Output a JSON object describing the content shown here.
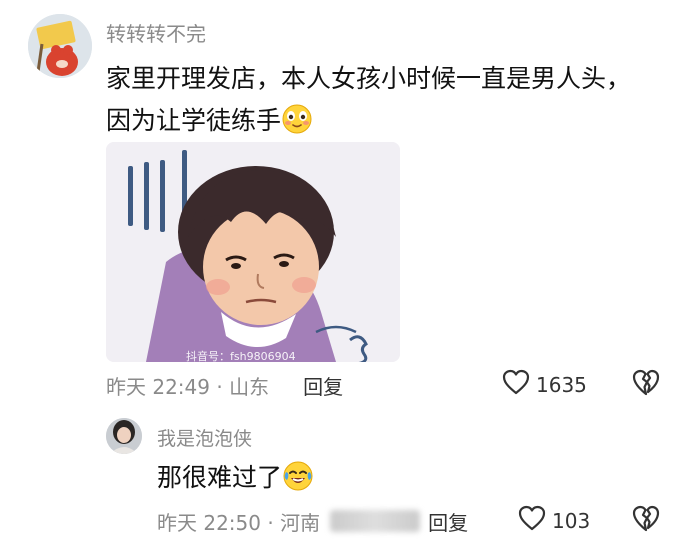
{
  "comment": {
    "username": "转转转不完",
    "text_line1": "家里开理发店，本人女孩小时候一直是男人头，",
    "text_line2": "因为让学徒练手",
    "inline_emoji": "smiling-face-emoji",
    "image_watermark": "抖音号：fsh9806904",
    "time": "昨天 22:49 · 山东",
    "reply_label": "回复",
    "like_count": "1635"
  },
  "reply": {
    "username": "我是泡泡侠",
    "text": "那很难过了",
    "inline_emoji": "crying-laughing-emoji",
    "time": "昨天 22:50 · 河南",
    "reply_label": "回复",
    "like_count": "103"
  },
  "icons": {
    "like": "heart-outline-icon",
    "dislike": "broken-heart-icon"
  },
  "colors": {
    "meta_gray": "#8a8a8a",
    "text_dark": "#111111",
    "purple_shirt": "#a37fb8",
    "hair": "#3b2a2c"
  }
}
